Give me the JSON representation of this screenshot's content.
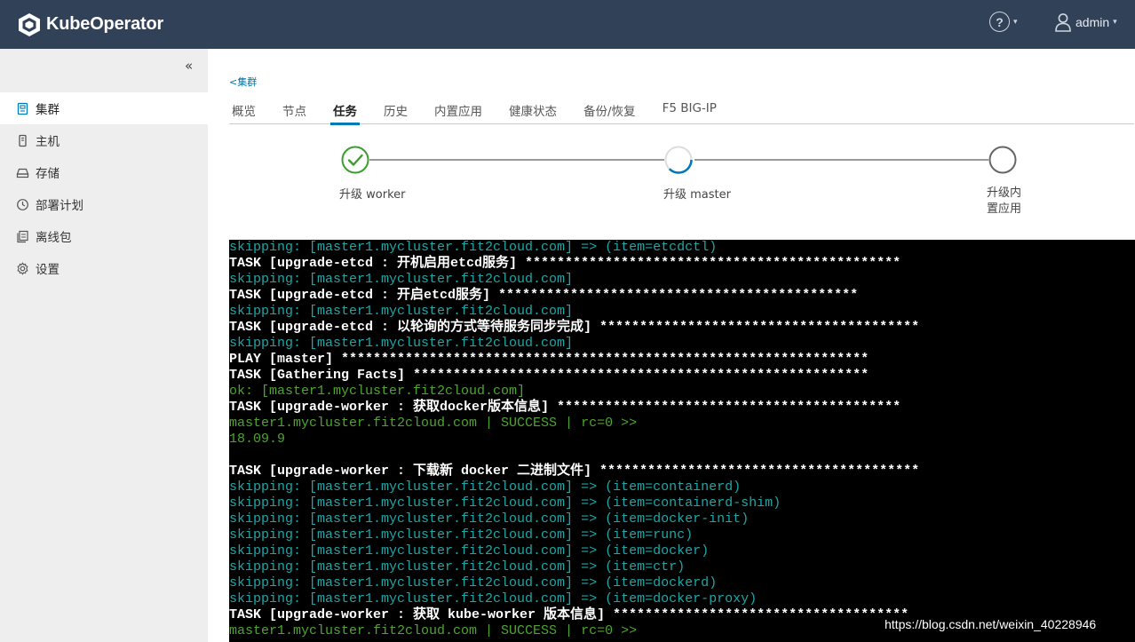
{
  "header": {
    "brand": "KubeOperator",
    "help_symbol": "?",
    "user_name": "admin"
  },
  "sidebar": {
    "collapse_symbol": "«",
    "items": [
      {
        "label": "集群",
        "icon": "cluster-icon",
        "active": true
      },
      {
        "label": "主机",
        "icon": "host-icon",
        "active": false
      },
      {
        "label": "存储",
        "icon": "storage-icon",
        "active": false
      },
      {
        "label": "部署计划",
        "icon": "plan-icon",
        "active": false
      },
      {
        "label": "离线包",
        "icon": "package-icon",
        "active": false
      },
      {
        "label": "设置",
        "icon": "gear-icon",
        "active": false
      }
    ]
  },
  "main": {
    "breadcrumb": "<集群",
    "tabs": [
      "概览",
      "节点",
      "任务",
      "历史",
      "内置应用",
      "健康状态",
      "备份/恢复",
      "F5 BIG-IP"
    ],
    "active_tab": "任务",
    "steps": [
      {
        "label": "升级 worker",
        "status": "done"
      },
      {
        "label": "升级 master",
        "status": "in-progress"
      },
      {
        "label_line1": "升级内",
        "label_line2": "置应用",
        "status": "pending"
      }
    ]
  },
  "terminal": {
    "lines": [
      {
        "c": "cyan",
        "t": "skipping: [master1.mycluster.fit2cloud.com] => (item=etcdctl)"
      },
      {
        "c": "white",
        "t": "TASK [upgrade-etcd : 开机启用etcd服务] ***********************************************"
      },
      {
        "c": "cyan",
        "t": "skipping: [master1.mycluster.fit2cloud.com]"
      },
      {
        "c": "white",
        "t": "TASK [upgrade-etcd : 开启etcd服务] *********************************************"
      },
      {
        "c": "cyan",
        "t": "skipping: [master1.mycluster.fit2cloud.com]"
      },
      {
        "c": "white",
        "t": "TASK [upgrade-etcd : 以轮询的方式等待服务同步完成] ****************************************"
      },
      {
        "c": "cyan",
        "t": "skipping: [master1.mycluster.fit2cloud.com]"
      },
      {
        "c": "white",
        "t": "PLAY [master] ******************************************************************"
      },
      {
        "c": "white",
        "t": "TASK [Gathering Facts] *********************************************************"
      },
      {
        "c": "green",
        "t": "ok: [master1.mycluster.fit2cloud.com]"
      },
      {
        "c": "white",
        "t": "TASK [upgrade-worker : 获取docker版本信息] *******************************************"
      },
      {
        "c": "green",
        "t": "master1.mycluster.fit2cloud.com | SUCCESS | rc=0 >>"
      },
      {
        "c": "green",
        "t": "18.09.9"
      },
      {
        "c": "green",
        "t": ""
      },
      {
        "c": "white",
        "t": "TASK [upgrade-worker : 下载新 docker 二进制文件] ****************************************"
      },
      {
        "c": "cyan",
        "t": "skipping: [master1.mycluster.fit2cloud.com] => (item=containerd)"
      },
      {
        "c": "cyan",
        "t": "skipping: [master1.mycluster.fit2cloud.com] => (item=containerd-shim)"
      },
      {
        "c": "cyan",
        "t": "skipping: [master1.mycluster.fit2cloud.com] => (item=docker-init)"
      },
      {
        "c": "cyan",
        "t": "skipping: [master1.mycluster.fit2cloud.com] => (item=runc)"
      },
      {
        "c": "cyan",
        "t": "skipping: [master1.mycluster.fit2cloud.com] => (item=docker)"
      },
      {
        "c": "cyan",
        "t": "skipping: [master1.mycluster.fit2cloud.com] => (item=ctr)"
      },
      {
        "c": "cyan",
        "t": "skipping: [master1.mycluster.fit2cloud.com] => (item=dockerd)"
      },
      {
        "c": "cyan",
        "t": "skipping: [master1.mycluster.fit2cloud.com] => (item=docker-proxy)"
      },
      {
        "c": "white",
        "t": "TASK [upgrade-worker : 获取 kube-worker 版本信息] *************************************"
      },
      {
        "c": "green",
        "t": "master1.mycluster.fit2cloud.com | SUCCESS | rc=0 >>"
      }
    ]
  },
  "watermark": "https://blog.csdn.net/weixin_40228946",
  "colors": {
    "header_bg": "#314158",
    "sidebar_bg": "#eeeeee",
    "accent": "#0079b8",
    "step_done": "#3c9e2d",
    "terminal_bg": "#000000",
    "log_cyan": "#1fa6a6",
    "log_green": "#4ea52e"
  }
}
